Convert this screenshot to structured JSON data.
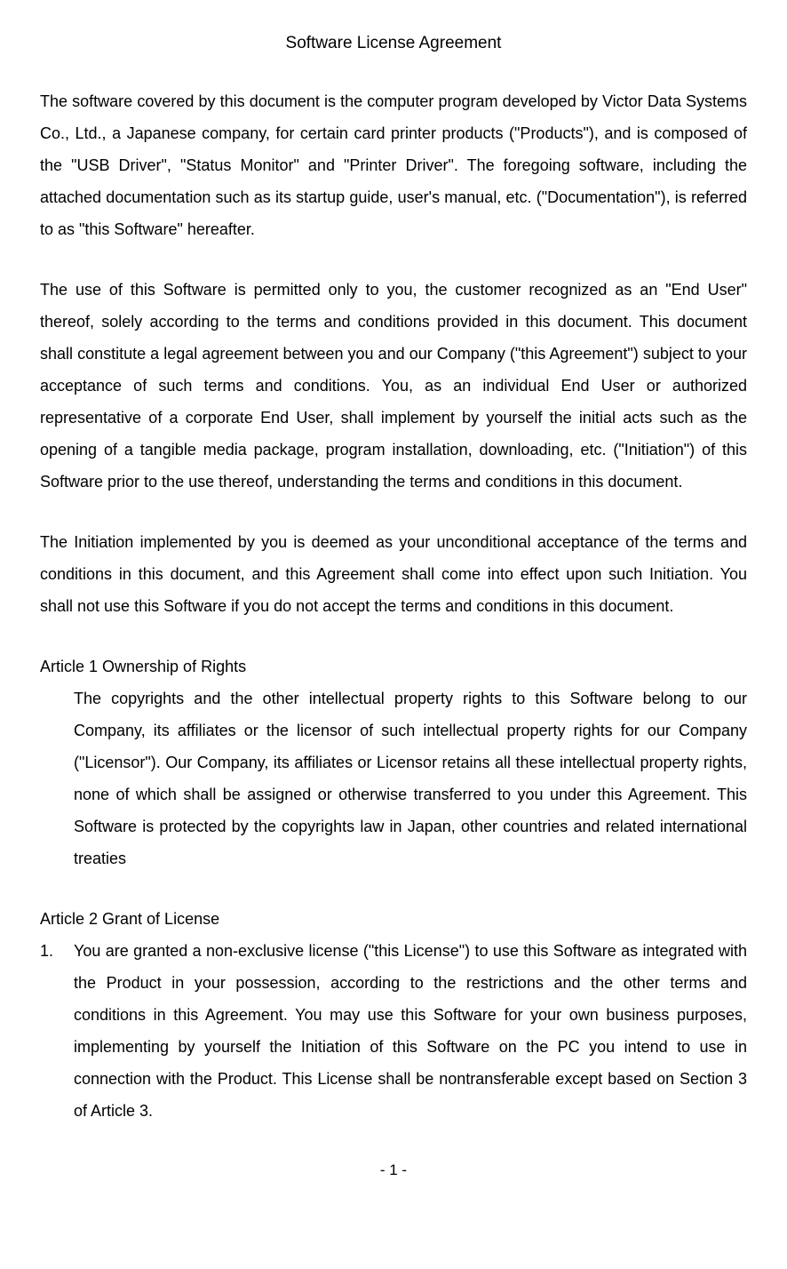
{
  "title": "Software License Agreement",
  "para1": "The software covered by this document is the computer program developed by Victor Data Systems Co., Ltd., a Japanese company, for certain card printer products (\"Products\"), and is composed of the \"USB Driver\", \"Status Monitor\" and \"Printer Driver\".   The foregoing software, including the attached documentation such as its startup guide, user's manual, etc. (\"Documentation\"), is referred to as \"this Software\" hereafter.",
  "para2": "The use of this Software is permitted only to you, the customer recognized as an \"End User\" thereof, solely according to the terms and conditions provided in this document.   This document shall constitute a legal agreement between you and our Company (\"this Agreement\") subject to your acceptance of such terms and conditions.   You, as an individual End User or authorized representative of a corporate End User, shall implement by yourself the initial acts such as the opening of a tangible media package, program installation, downloading, etc. (\"Initiation\") of this Software prior to the use thereof, understanding the terms and conditions in this document.",
  "para3": "The Initiation implemented by you is deemed as your unconditional acceptance of the terms and conditions in this document, and this Agreement shall come into effect upon such Initiation. You shall not use this Software if you do not accept the terms and conditions in this document.",
  "article1": {
    "heading": "Article 1    Ownership of Rights",
    "body": "The copyrights and the other intellectual property rights to this Software belong to our Company, its affiliates or the licensor of such intellectual property rights for our Company (\"Licensor\").   Our Company, its affiliates or Licensor retains all these intellectual property rights, none of which shall be assigned or otherwise transferred to you under this Agreement.    This Software is protected by the copyrights law in Japan, other countries and related international treaties"
  },
  "article2": {
    "heading": "Article 2    Grant of License",
    "item1_num": "1.",
    "item1_body": "You are granted a non-exclusive license (\"this License\") to use this Software as integrated with the Product in your possession, according to the restrictions and the other terms and conditions in this Agreement.   You may use this Software for your own business purposes, implementing by yourself the Initiation of this Software on the PC you intend to use in connection with the Product.   This License shall be nontransferable except based on Section 3 of Article 3."
  },
  "page_number": "- 1 -"
}
